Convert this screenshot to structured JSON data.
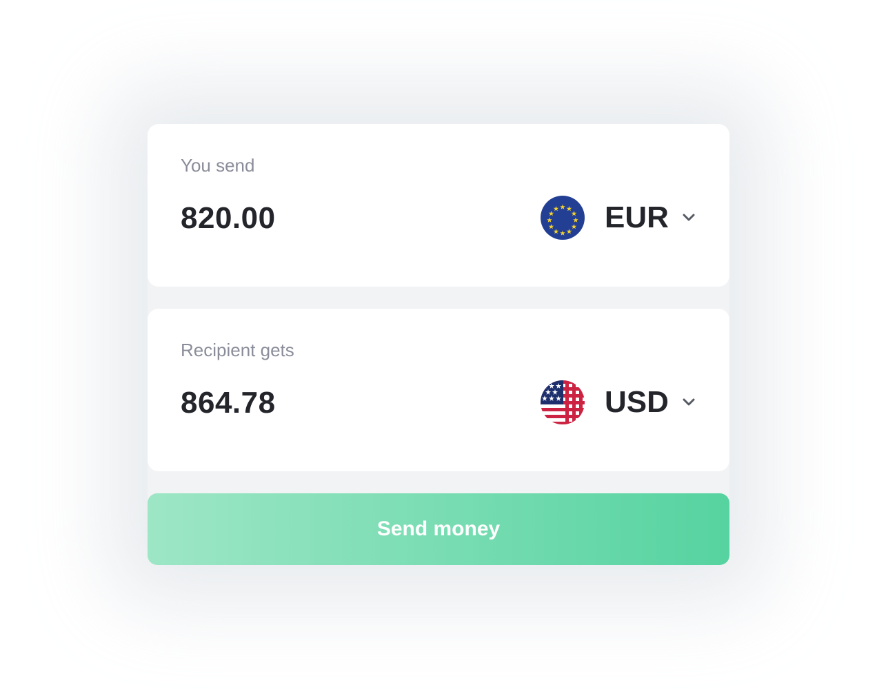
{
  "send": {
    "label": "You send",
    "amount": "820.00",
    "currency_code": "EUR",
    "flag_icon": "eu-flag-icon"
  },
  "receive": {
    "label": "Recipient gets",
    "amount": "864.78",
    "currency_code": "USD",
    "flag_icon": "us-flag-icon"
  },
  "action": {
    "label": "Send money"
  },
  "colors": {
    "accent_start": "#9de6c6",
    "accent_end": "#56d3a0",
    "label": "#8a8d99",
    "text": "#23252b"
  }
}
